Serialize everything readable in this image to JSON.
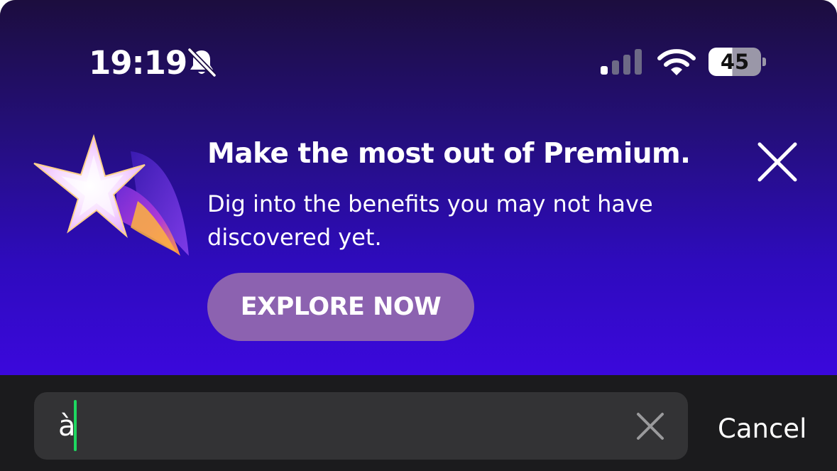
{
  "status_bar": {
    "time": "19:19",
    "battery_percent": "45",
    "battery_level": 0.45,
    "silent_icon": "bell-slash-icon",
    "signal_icon": "cellular-signal-icon",
    "wifi_icon": "wifi-icon",
    "signal_bars_active": 1,
    "signal_bars_total": 4
  },
  "promo": {
    "title": "Make the most out of Premium.",
    "body": "Dig into the benefits you may not have discovered yet.",
    "cta_label": "EXPLORE NOW",
    "close_icon": "close-icon",
    "art_icon": "shooting-star-icon",
    "colors": {
      "banner_top": "#1c0d3e",
      "banner_bottom": "#3b08dc",
      "cta_background": "#8c62b0"
    }
  },
  "search": {
    "value": "à",
    "clear_icon": "clear-icon",
    "cancel_label": "Cancel",
    "caret_color": "#1ed760"
  }
}
